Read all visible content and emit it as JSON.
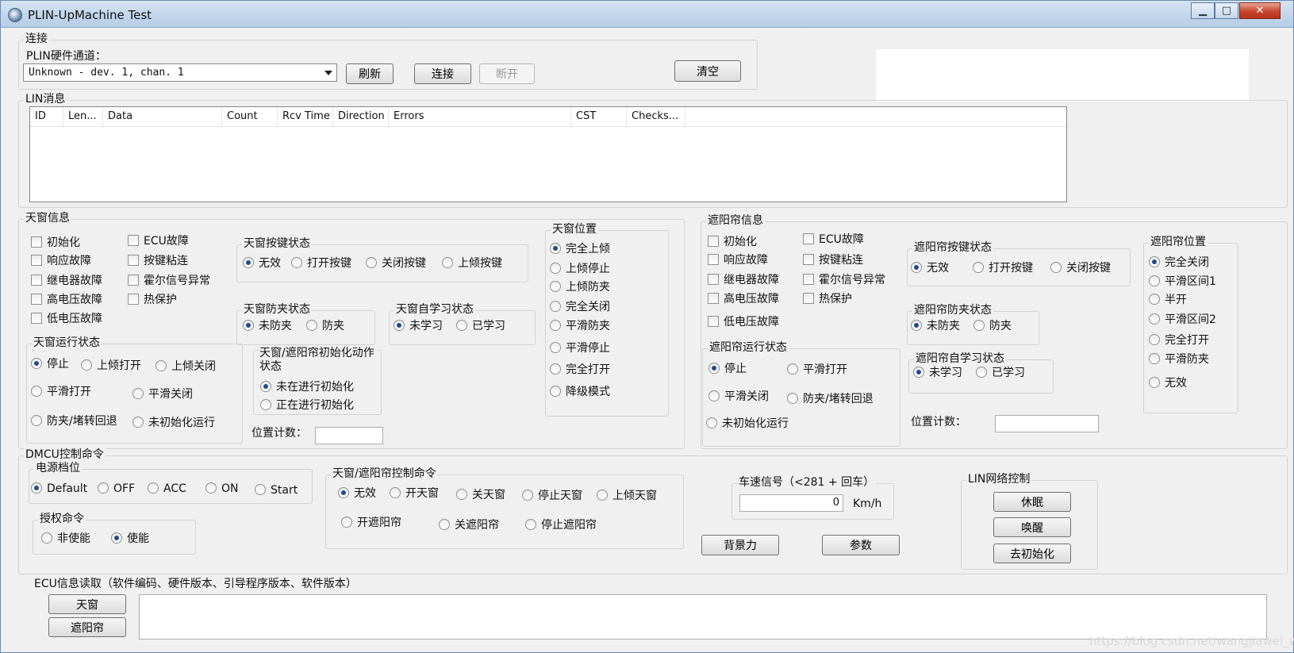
{
  "window": {
    "title": "PLIN-UpMachine Test"
  },
  "conn": {
    "group_label": "连接",
    "channel_label": "PLIN硬件通道：",
    "channel_value": "Unknown - dev. 1, chan. 1",
    "refresh": "刷新",
    "connect": "连接",
    "disconnect": "断开",
    "clear": "清空"
  },
  "lin": {
    "group_label": "LIN消息",
    "columns": [
      "ID",
      "Len...",
      "Data",
      "Count",
      "Rcv Time",
      "Direction",
      "Errors",
      "CST",
      "Checks..."
    ]
  },
  "skylight": {
    "group_label": "天窗信息",
    "faults_left": [
      "初始化",
      "响应故障",
      "继电器故障",
      "高电压故障",
      "低电压故障"
    ],
    "faults_right": [
      "ECU故障",
      "按键粘连",
      "霍尔信号异常",
      "热保护"
    ],
    "key_state": {
      "label": "天窗按键状态",
      "options": [
        "无效",
        "打开按键",
        "关闭按键",
        "上倾按键"
      ]
    },
    "pinch_state": {
      "label": "天窗防夹状态",
      "options": [
        "未防夹",
        "防夹"
      ]
    },
    "learn_state": {
      "label": "天窗自学习状态",
      "options": [
        "未学习",
        "已学习"
      ]
    },
    "position": {
      "label": "天窗位置",
      "options": [
        "完全上倾",
        "上倾停止",
        "上倾防夹",
        "完全关闭",
        "平滑防夹",
        "平滑停止",
        "完全打开",
        "降级模式"
      ]
    },
    "run_state": {
      "label": "天窗运行状态",
      "options": [
        "停止",
        "上倾打开",
        "上倾关闭",
        "平滑打开",
        "平滑关闭",
        "防夹/堵转回退",
        "未初始化运行"
      ]
    },
    "init_state": {
      "label": "天窗/遮阳帘初始化动作状态",
      "options": [
        "未在进行初始化",
        "正在进行初始化"
      ]
    },
    "pos_count_label": "位置计数："
  },
  "shade": {
    "group_label": "遮阳帘信息",
    "faults_left": [
      "初始化",
      "响应故障",
      "继电器故障",
      "高电压故障",
      "低电压故障"
    ],
    "faults_right": [
      "ECU故障",
      "按键粘连",
      "霍尔信号异常",
      "热保护"
    ],
    "key_state": {
      "label": "遮阳帘按键状态",
      "options": [
        "无效",
        "打开按键",
        "关闭按键"
      ]
    },
    "pinch_state": {
      "label": "遮阳帘防夹状态",
      "options": [
        "未防夹",
        "防夹"
      ]
    },
    "learn_state": {
      "label": "遮阳帘自学习状态",
      "options": [
        "未学习",
        "已学习"
      ]
    },
    "position": {
      "label": "遮阳帘位置",
      "options": [
        "完全关闭",
        "平滑区间1",
        "半开",
        "平滑区间2",
        "完全打开",
        "平滑防夹",
        "无效"
      ]
    },
    "run_state": {
      "label": "遮阳帘运行状态",
      "options": [
        "停止",
        "平滑打开",
        "平滑关闭",
        "防夹/堵转回退",
        "未初始化运行"
      ]
    },
    "pos_count_label": "位置计数："
  },
  "dmcu": {
    "group_label": "DMCU控制命令",
    "power": {
      "label": "电源档位",
      "options": [
        "Default",
        "OFF",
        "ACC",
        "ON",
        "Start"
      ]
    },
    "auth": {
      "label": "授权命令",
      "options": [
        "非使能",
        "使能"
      ]
    },
    "ctrl": {
      "label": "天窗/遮阳帘控制命令",
      "options": [
        "无效",
        "开天窗",
        "关天窗",
        "停止天窗",
        "上倾天窗",
        "开遮阳帘",
        "关遮阳帘",
        "停止遮阳帘"
      ]
    },
    "speed": {
      "label": "车速信号（<281 + 回车）",
      "value": "0",
      "unit": "Km/h"
    },
    "backlight": "背景力",
    "params": "参数",
    "lin_ctrl": {
      "label": "LIN网络控制",
      "sleep": "休眠",
      "wake": "唤醒",
      "deinit": "去初始化"
    }
  },
  "ecu": {
    "label": "ECU信息读取（软件编码、硬件版本、引导程序版本、软件版本）",
    "sky_btn": "天窗",
    "shade_btn": "遮阳帘"
  },
  "watermark": "https://blog.csdn.net/wangjiawei_wei"
}
